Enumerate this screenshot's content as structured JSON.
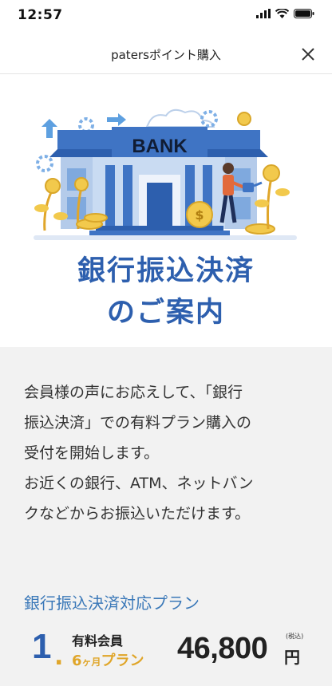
{
  "status_bar": {
    "time": "12:57"
  },
  "header": {
    "title": "patersポイント購入"
  },
  "hero": {
    "bank_sign": "BANK",
    "title_line1": "銀行振込決済",
    "title_line2": "のご案内"
  },
  "intro": {
    "lines": [
      "会員様の声にお応えして、「銀行",
      "振込決済」での有料プラン購入の",
      "受付を開始します。",
      "お近くの銀行、ATM、ネットバン",
      "クなどからお振込いただけます。"
    ]
  },
  "plans": {
    "heading": "銀行振込決済対応プラン",
    "items": [
      {
        "number": "1",
        "name": "有料会員",
        "duration_num": "6",
        "duration_unit": "ヶ月",
        "duration_suffix": "プラン",
        "price": "46,800",
        "tax_note": "(税込)",
        "currency": "円"
      }
    ]
  },
  "colors": {
    "accent_blue": "#2d5fae",
    "heading_blue": "#3a78b8",
    "gold": "#e0a62a",
    "section_bg": "#f2f2f2"
  }
}
